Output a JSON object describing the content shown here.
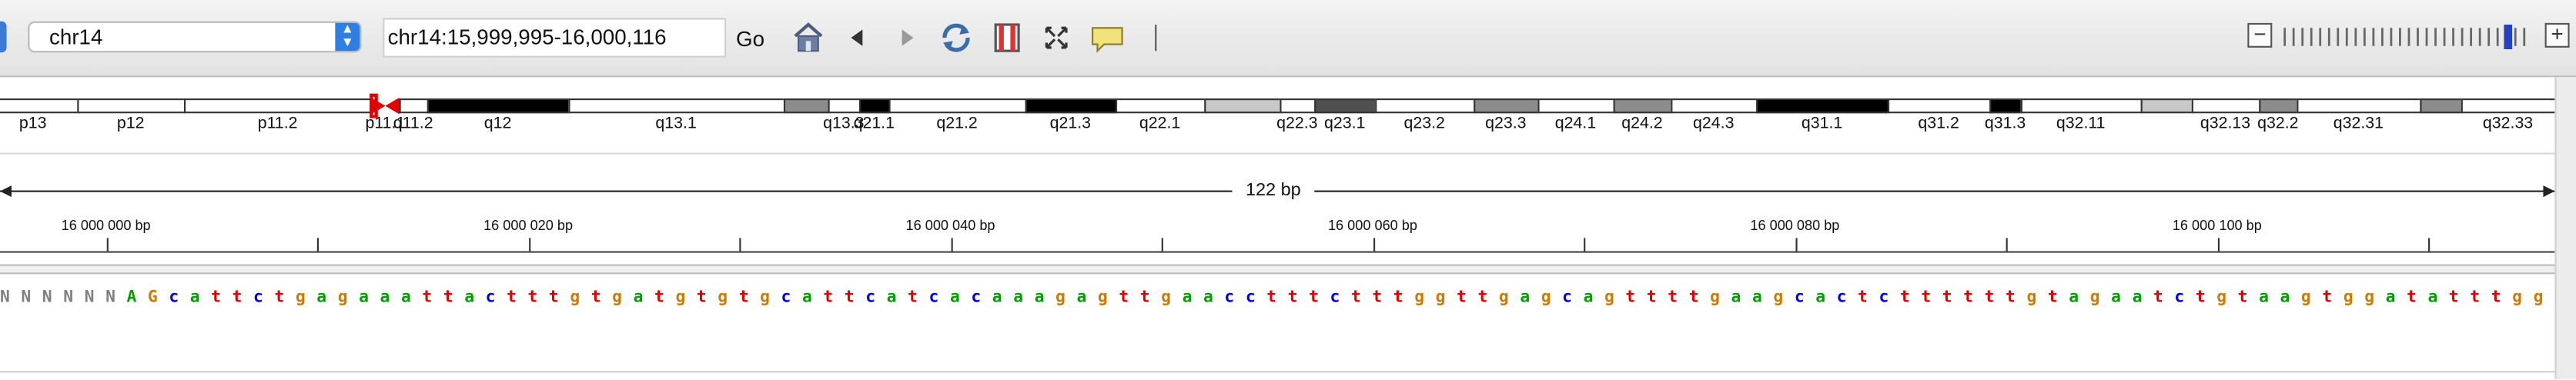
{
  "toolbar": {
    "genome": "chr14",
    "locus": "chr14:15,999,995-16,000,116",
    "go_label": "Go",
    "icons": [
      "home-icon",
      "back-icon",
      "forward-icon",
      "refresh-icon",
      "region-icon",
      "fit-icon",
      "popup-icon"
    ],
    "zoom_minus": "−",
    "zoom_plus": "+",
    "zoom_level_fraction": 0.93
  },
  "ideogram": {
    "bands": [
      {
        "label": "p13",
        "stain": "gneg"
      },
      {
        "label": "p12",
        "stain": "gneg"
      },
      {
        "label": "p11.2",
        "stain": "gneg"
      },
      {
        "label": "p11.1",
        "stain": "acen"
      },
      {
        "label": "q11.2",
        "stain": "gneg"
      },
      {
        "label": "q12",
        "stain": "gpos100"
      },
      {
        "label": "q13.1",
        "stain": "gneg"
      },
      {
        "label": "",
        "stain": "gpos50"
      },
      {
        "label": "q13.3",
        "stain": "gneg"
      },
      {
        "label": "q21.1",
        "stain": "gpos100"
      },
      {
        "label": "q21.2",
        "stain": "gneg"
      },
      {
        "label": "q21.3",
        "stain": "gpos100"
      },
      {
        "label": "q22.1",
        "stain": "gneg"
      },
      {
        "label": "",
        "stain": "gpos25"
      },
      {
        "label": "q22.3",
        "stain": "gneg"
      },
      {
        "label": "q23.1",
        "stain": "gpos75"
      },
      {
        "label": "q23.2",
        "stain": "gneg"
      },
      {
        "label": "q23.3",
        "stain": "gpos50"
      },
      {
        "label": "q24.1",
        "stain": "gneg"
      },
      {
        "label": "q24.2",
        "stain": "gpos50"
      },
      {
        "label": "q24.3",
        "stain": "gneg"
      },
      {
        "label": "q31.1",
        "stain": "gpos100"
      },
      {
        "label": "q31.2",
        "stain": "gneg"
      },
      {
        "label": "q31.3",
        "stain": "gpos100"
      },
      {
        "label": "q32.11",
        "stain": "gneg"
      },
      {
        "label": "",
        "stain": "gpos25"
      },
      {
        "label": "q32.13",
        "stain": "gneg"
      },
      {
        "label": "q32.2",
        "stain": "gpos50"
      },
      {
        "label": "q32.31",
        "stain": "gneg"
      },
      {
        "label": "",
        "stain": "gpos50"
      },
      {
        "label": "q32.33",
        "stain": "gneg"
      }
    ],
    "stain_colors": {
      "gneg": "#ffffff",
      "gpos25": "#c8c8c8",
      "gpos50": "#8c8c8c",
      "gpos75": "#505050",
      "gpos100": "#000000",
      "acen": "#e00000"
    }
  },
  "ruler": {
    "span_label": "122 bp",
    "tick_labels": [
      "16 000 000 bp",
      "16 000 020 bp",
      "16 000 040 bp",
      "16 000 060 bp",
      "16 000 080 bp",
      "16 000 100 bp"
    ]
  },
  "sequence": {
    "bases": "NNNNNNAGcattctgagaaattactttgtgatgtgtgcattcatcacaaagagttgaacctttctttggttgagcagttttgaagcactcttttttgtagaatctgtaagtggatatttgga",
    "colors": {
      "a": "#00a000",
      "c": "#0000e0",
      "g": "#d17a00",
      "t": "#e00000",
      "n": "#808080"
    }
  }
}
